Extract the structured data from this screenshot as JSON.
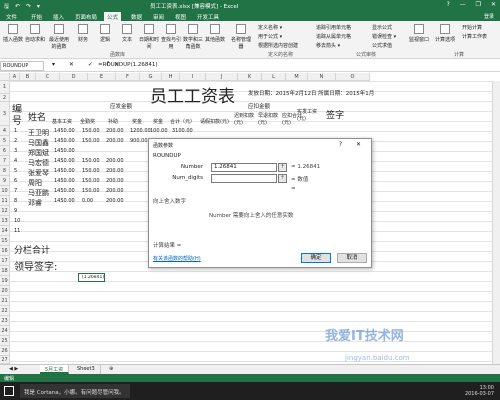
{
  "window": {
    "title": "员工工资表.xlsx [兼容模式] - Excel",
    "qat": "🖫 ↶ ↷ ▾",
    "controls": [
      "?",
      "—",
      "❐",
      "✕"
    ]
  },
  "ribbon_tabs": [
    "文件",
    "开始",
    "插入",
    "页面布局",
    "公式",
    "数据",
    "审阅",
    "视图",
    "开发工具"
  ],
  "active_tab": "公式",
  "login_label": "登录",
  "ribbon": {
    "buttons": [
      "插入函数",
      "自动求和",
      "最近使用的函数",
      "财务",
      "逻辑",
      "文本",
      "日期和时间",
      "查找与引用",
      "数学和三角函数",
      "其他函数",
      "名称管理器",
      "计算选项"
    ],
    "small_items": [
      "定义名称 ▾",
      "用于公式 ▾",
      "根据所选内容创建",
      "追踪引用单元格",
      "追踪从属单元格",
      "移去箭头 ▾",
      "显示公式",
      "错误检查 ▾",
      "公式求值",
      "监视窗口",
      "开始计算",
      "计算工作表"
    ],
    "groups": [
      "函数库",
      "定义的名称",
      "公式审核",
      "计算"
    ]
  },
  "formula_bar": {
    "name_box": "ROUNDUP",
    "icons": "▾ ✕ ✓ fx",
    "formula": "=ROUNDUP(1.26841)"
  },
  "columns": [
    "A",
    "B",
    "C",
    "D",
    "E",
    "F",
    "G",
    "H",
    "I",
    "J",
    "K",
    "L",
    "M",
    "N",
    "O"
  ],
  "rows": [
    "1",
    "2",
    "3",
    "4",
    "5",
    "6",
    "7",
    "8",
    "9",
    "10",
    "11",
    "12",
    "13",
    "14",
    "15",
    "16",
    "17",
    "18",
    "19",
    "20",
    "21",
    "22",
    "23",
    "24",
    "25",
    "26",
    "27",
    "28"
  ],
  "sheet": {
    "title": "员工工资表",
    "issue_date": "发放日期：2015年2月12日 所属日期：2015年1月",
    "headers": {
      "no": "编号",
      "name": "姓名",
      "should_pay": "应发金额",
      "deduct": "应扣金额",
      "basic": "基本工资",
      "fulltime": "全勤奖",
      "subsidy": "补助",
      "allowance": "奖金",
      "bonus": "奖金",
      "subtotal": "合计（元）",
      "late": "请假扣款(元)",
      "absent": "迟到扣款(元)",
      "leave_early": "早退扣款(元)",
      "deduct_total": "应扣合计(元)",
      "actual": "实发工资(元)",
      "sign": "签字"
    },
    "employees": [
      {
        "no": "1",
        "name": "王卫明",
        "basic": "1450.00",
        "fulltime": "150.00",
        "subsidy": "200.00",
        "allowance": "1200.00",
        "bonus": "100.00",
        "subtotal": "3100.00"
      },
      {
        "no": "2",
        "name": "马国鑫",
        "basic": "1450.00",
        "fulltime": "150.00",
        "subsidy": "200.00",
        "allowance": "900.00",
        "bonus": "",
        "subtotal": ""
      },
      {
        "no": "3",
        "name": "郑国斌",
        "basic": "1450.00",
        "fulltime": "",
        "subsidy": "",
        "allowance": "",
        "bonus": "",
        "subtotal": ""
      },
      {
        "no": "4",
        "name": "马宏德",
        "basic": "1450.00",
        "fulltime": "150.00",
        "subsidy": "200.00",
        "allowance": "",
        "bonus": "",
        "subtotal": ""
      },
      {
        "no": "5",
        "name": "张爱琴",
        "basic": "1450.00",
        "fulltime": "150.00",
        "subsidy": "200.00",
        "allowance": "",
        "bonus": "",
        "subtotal": ""
      },
      {
        "no": "6",
        "name": "周阳",
        "basic": "1450.00",
        "fulltime": "150.00",
        "subsidy": "200.00",
        "allowance": "",
        "bonus": "",
        "subtotal": ""
      },
      {
        "no": "7",
        "name": "马亚鹏",
        "basic": "1450.00",
        "fulltime": "150.00",
        "subsidy": "200.00",
        "allowance": "",
        "bonus": "",
        "subtotal": ""
      },
      {
        "no": "8",
        "name": "邓睿",
        "basic": "1450.00",
        "fulltime": "0.00",
        "subsidy": "200.00",
        "allowance": "",
        "bonus": "",
        "subtotal": ""
      },
      {
        "no": "9",
        "name": "",
        "basic": "",
        "fulltime": "",
        "subsidy": "",
        "allowance": "",
        "bonus": "",
        "subtotal": ""
      },
      {
        "no": "10",
        "name": "",
        "basic": "",
        "fulltime": "",
        "subsidy": "",
        "allowance": "",
        "bonus": "",
        "subtotal": ""
      },
      {
        "no": "11",
        "name": "",
        "basic": "",
        "fulltime": "",
        "subsidy": "",
        "allowance": "",
        "bonus": "",
        "subtotal": ""
      }
    ],
    "subtotal_label": "分栏合计",
    "leader_sign": "领导签字:",
    "active_cell_text": "(1.26841)"
  },
  "dialog": {
    "title": "函数参数",
    "controls": "? ✕",
    "function_name": "ROUNDUP",
    "number_label": "Number",
    "number_value": "1.26841",
    "number_result": "= 1.26841",
    "digits_label": "Num_digits",
    "digits_value": "",
    "digits_result": "= 数值",
    "equals_sign": "=",
    "description": "向上舍入数字",
    "arg_help": "Number   需要向上舍入的任意实数",
    "result_label": "计算结果 =",
    "help_link": "有关该函数的帮助(H)",
    "ok": "确定",
    "cancel": "取消"
  },
  "sheet_tabs": [
    "5月工资",
    "Sheet3"
  ],
  "status_text": "编辑",
  "taskbar": {
    "search": "我是 Cortana，小娜。有问题尽管问我。",
    "time": "13:00",
    "date": "2016-03-07"
  },
  "watermark": {
    "main": "我爱IT技术网",
    "url": "jingyan.baidu.com"
  }
}
